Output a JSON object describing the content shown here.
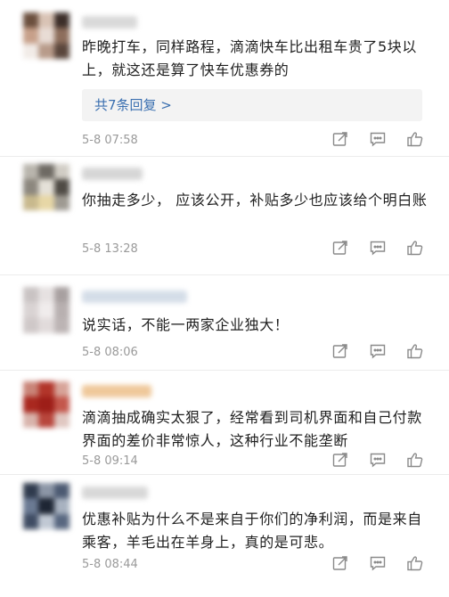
{
  "comments": [
    {
      "text": "昨晚打车，同样路程，滴滴快车比出租车贵了5块以上，就这还是算了快车优惠券的",
      "reply": "共7条回复 >",
      "time": "5-8 07:58",
      "colors": [
        "#6b4f3d",
        "#d9c3b5",
        "#3c2e29",
        "#c7a08a",
        "#e8dcd5",
        "#8d6e5c",
        "#f1ebe7",
        "#b89b8a",
        "#5a463c"
      ],
      "namebar": "#d9d9d9"
    },
    {
      "text": "你抽走多少，  应该公开，补贴多少也应该给个明白账",
      "time": "5-8 13:28",
      "colors": [
        "#b9b5ad",
        "#6e6a63",
        "#d1cdc5",
        "#8c877e",
        "#e5e1d8",
        "#4f4b45",
        "#c8b98d",
        "#e7d7a6",
        "#9e9a92"
      ],
      "namebar": "#d6d6d6"
    },
    {
      "text": "说实话，不能一两家企业独大！",
      "time": "5-8 08:06",
      "colors": [
        "#c9c3c3",
        "#e6e1e1",
        "#a8a0a0",
        "#d9d3d3",
        "#f0ecec",
        "#b8b0b0",
        "#cfc8c8",
        "#e1dbdb",
        "#bcb4b4"
      ],
      "namebar": "#d4dde8"
    },
    {
      "text": "滴滴抽成确实太狠了，经常看到司机界面和自己付款界面的差价非常惊人，这种行业不能垄断",
      "time": "5-8 09:14",
      "colors": [
        "#c98478",
        "#b2352a",
        "#d7a398",
        "#a9281f",
        "#9d1e18",
        "#c4574c",
        "#d8b3ab",
        "#b8463c",
        "#e0c7c1"
      ],
      "namebar": "#efc89a"
    },
    {
      "text": "优惠补贴为什么不是来自于你们的净利润，而是来自乘客，羊毛出在羊身上，真的是可悲。",
      "time": "5-8 08:44",
      "colors": [
        "#2f3a4d",
        "#8c96a6",
        "#4c5a72",
        "#6b7a93",
        "#1e2634",
        "#a8b2c0",
        "#3f4c63",
        "#c1c9d4",
        "#586780"
      ],
      "namebar": "#d8d8d8"
    }
  ]
}
